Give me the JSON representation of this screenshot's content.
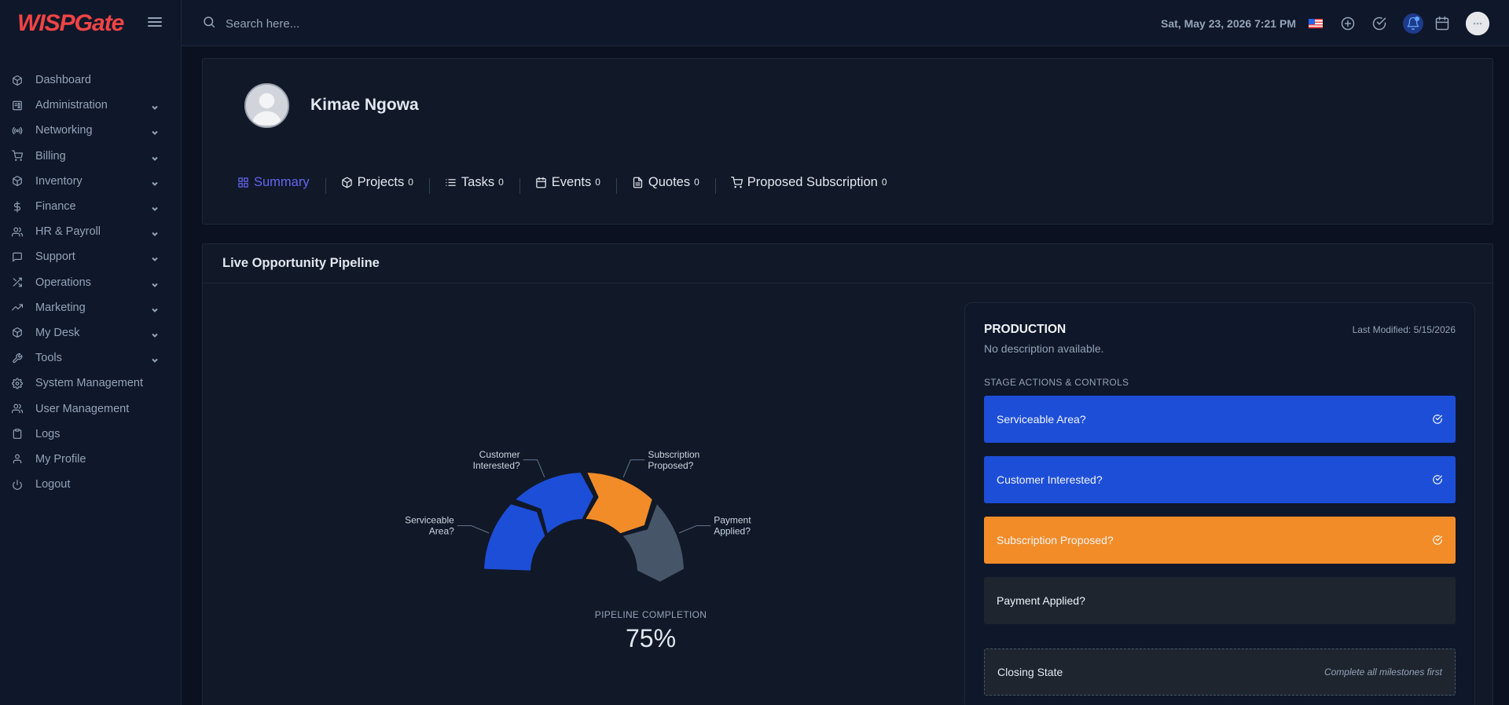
{
  "app": {
    "logo": "WISPGate"
  },
  "sidebar": {
    "items": [
      {
        "label": "Dashboard",
        "icon": "box-icon",
        "expandable": false
      },
      {
        "label": "Administration",
        "icon": "admin-icon",
        "expandable": true
      },
      {
        "label": "Networking",
        "icon": "broadcast-icon",
        "expandable": true
      },
      {
        "label": "Billing",
        "icon": "cart-icon",
        "expandable": true
      },
      {
        "label": "Inventory",
        "icon": "package-icon",
        "expandable": true
      },
      {
        "label": "Finance",
        "icon": "dollar-icon",
        "expandable": true
      },
      {
        "label": "HR & Payroll",
        "icon": "users-icon",
        "expandable": true
      },
      {
        "label": "Support",
        "icon": "message-icon",
        "expandable": true
      },
      {
        "label": "Operations",
        "icon": "shuffle-icon",
        "expandable": true
      },
      {
        "label": "Marketing",
        "icon": "trending-icon",
        "expandable": true
      },
      {
        "label": "My Desk",
        "icon": "cube-icon",
        "expandable": true
      },
      {
        "label": "Tools",
        "icon": "wrench-icon",
        "expandable": true
      },
      {
        "label": "System Management",
        "icon": "gear-icon",
        "expandable": false
      },
      {
        "label": "User Management",
        "icon": "user-group-icon",
        "expandable": false
      },
      {
        "label": "Logs",
        "icon": "clipboard-icon",
        "expandable": false
      },
      {
        "label": "My Profile",
        "icon": "user-icon",
        "expandable": false
      },
      {
        "label": "Logout",
        "icon": "power-icon",
        "expandable": false
      }
    ]
  },
  "header": {
    "search_placeholder": "Search here...",
    "datetime": "Sat, May 23, 2026 7:21 PM"
  },
  "profile": {
    "name": "Kimae Ngowa",
    "tabs": [
      {
        "label": "Summary",
        "count": "",
        "icon": "grid-icon",
        "active": true
      },
      {
        "label": "Projects",
        "count": "0",
        "icon": "package-icon",
        "active": false
      },
      {
        "label": "Tasks",
        "count": "0",
        "icon": "list-icon",
        "active": false
      },
      {
        "label": "Events",
        "count": "0",
        "icon": "calendar-icon",
        "active": false
      },
      {
        "label": "Quotes",
        "count": "0",
        "icon": "document-icon",
        "active": false
      },
      {
        "label": "Proposed Subscription",
        "count": "0",
        "icon": "cart-icon",
        "active": false
      }
    ]
  },
  "pipeline": {
    "title": "Live Opportunity Pipeline",
    "completion_label": "PIPELINE COMPLETION",
    "completion_value": "75%"
  },
  "chart_data": {
    "type": "pie",
    "subtype": "semi-donut-chevron",
    "categories": [
      "Serviceable Area?",
      "Customer Interested?",
      "Subscription Proposed?",
      "Payment Applied?"
    ],
    "values": [
      1,
      1,
      1,
      1
    ],
    "completed": [
      true,
      true,
      true,
      false
    ],
    "colors": [
      "#1d4ed8",
      "#1d4ed8",
      "#f28c28",
      "#475569"
    ],
    "labels": [
      [
        "Serviceable",
        "Area?"
      ],
      [
        "Customer",
        "Interested?"
      ],
      [
        "Subscription",
        "Proposed?"
      ],
      [
        "Payment",
        "Applied?"
      ]
    ]
  },
  "stage": {
    "title": "PRODUCTION",
    "last_modified": "Last Modified: 5/15/2026",
    "description": "No description available.",
    "section_label": "STAGE ACTIONS & CONTROLS",
    "actions": [
      {
        "label": "Serviceable Area?",
        "color": "#1d4ed8",
        "done": true
      },
      {
        "label": "Customer Interested?",
        "color": "#1d4ed8",
        "done": true
      },
      {
        "label": "Subscription Proposed?",
        "color": "#f28c28",
        "done": true
      },
      {
        "label": "Payment Applied?",
        "color": "#1e252f",
        "done": false
      }
    ],
    "closing": {
      "label": "Closing State",
      "hint": "Complete all milestones first"
    }
  }
}
